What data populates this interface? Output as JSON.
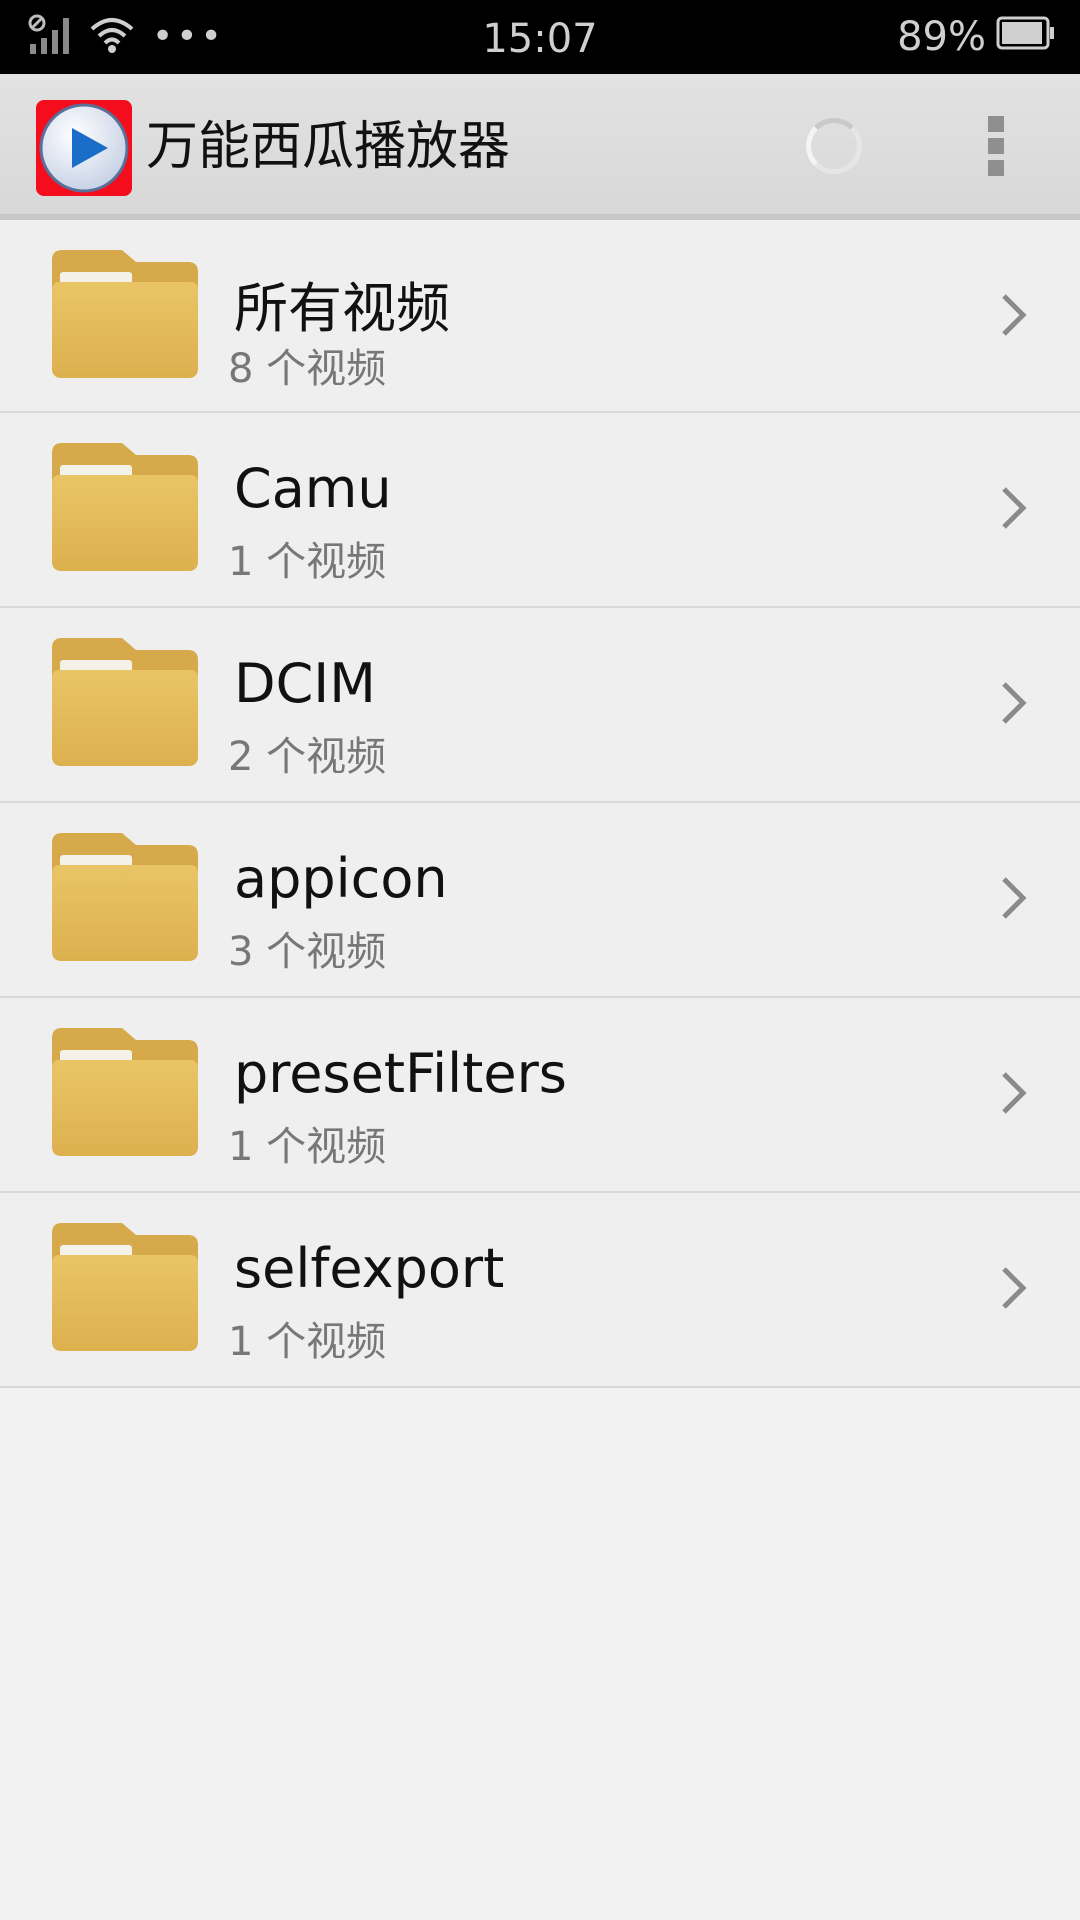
{
  "status_bar": {
    "time": "15:07",
    "battery": "89%",
    "icons": [
      "no-sim-signal-icon",
      "wifi-icon",
      "more-notifications-icon",
      "battery-icon"
    ]
  },
  "app_bar": {
    "title": "万能西瓜播放器",
    "logo_icon": "play-logo-icon",
    "loading_icon": "loading-spinner-icon",
    "menu_icon": "overflow-menu-icon"
  },
  "folders": [
    {
      "name": "所有视频",
      "count": "8 个视频"
    },
    {
      "name": "Camu",
      "count": "1 个视频"
    },
    {
      "name": "DCIM",
      "count": "2 个视频"
    },
    {
      "name": "appicon",
      "count": "3 个视频"
    },
    {
      "name": "presetFilters",
      "count": "1 个视频"
    },
    {
      "name": "selfexport",
      "count": "1 个视频"
    }
  ],
  "colors": {
    "status_bar_bg": "#000000",
    "app_bar_bg": "#dcdcdc",
    "logo_bg": "#f40d1c",
    "logo_play": "#1a6ec8",
    "folder_yellow": "#e3b652",
    "chevron": "#8a8a8a",
    "list_bg": "#efefef"
  }
}
